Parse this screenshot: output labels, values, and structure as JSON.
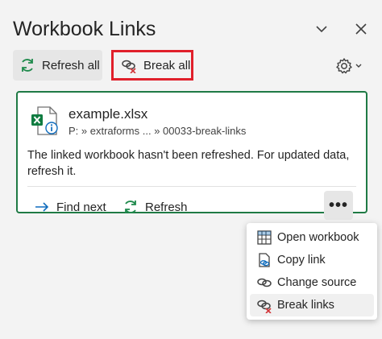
{
  "pane": {
    "title": "Workbook Links",
    "chevron_icon": "chevron-down-icon",
    "close_icon": "close-icon"
  },
  "toolbar": {
    "refresh_all_label": "Refresh all",
    "break_all_label": "Break all",
    "settings_icon": "gear-icon",
    "highlight_color": "#e0202b"
  },
  "link_card": {
    "file_name": "example.xlsx",
    "file_path": "P: » extraforms  ... » 00033-break-links",
    "status_message": "The linked workbook hasn't been refreshed. For updated data, refresh it.",
    "find_next_label": "Find next",
    "refresh_label": "Refresh",
    "more_label": "•••",
    "border_color": "#1f7a45"
  },
  "context_menu": {
    "items": [
      {
        "label": "Open workbook",
        "icon": "open-workbook-icon"
      },
      {
        "label": "Copy link",
        "icon": "copy-link-icon"
      },
      {
        "label": "Change source",
        "icon": "change-source-icon"
      },
      {
        "label": "Break links",
        "icon": "break-link-icon"
      }
    ]
  }
}
